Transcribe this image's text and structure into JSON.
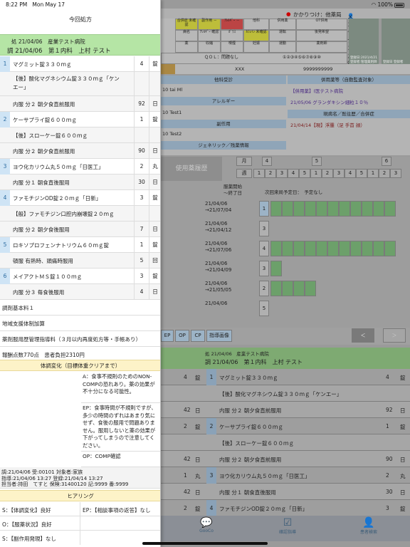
{
  "status": {
    "time": "8:22 PM",
    "date": "Mon May 17",
    "battery": "100%"
  },
  "header": {
    "kakaritsuke": "かかりつけ：他薬局",
    "user": "メンテナンス管理者"
  },
  "panel": {
    "title": "今回処方",
    "rx_line1": "処 21/04/06　産業テスト病院",
    "rx_line2": "調 21/04/06　第１内科　上村 テスト",
    "meds": [
      {
        "num": "1",
        "name": "マグミット錠３３０ｍｇ",
        "qty": "4",
        "unit": "錠"
      },
      {
        "name": "【後】酸化マグネシウム錠３３０ｍｇ「ケン",
        "name2": "エー」"
      },
      {
        "name": "内服 分２ 朝夕食直前服用",
        "qty": "92",
        "unit": "日"
      },
      {
        "num": "2",
        "name": "ケーサプライ錠６００ｍｇ",
        "qty": "1",
        "unit": "錠"
      },
      {
        "name": "【後】スローケー錠６００ｍｇ"
      },
      {
        "name": "内服 分２ 朝夕食直前服用",
        "qty": "90",
        "unit": "日"
      },
      {
        "num": "3",
        "name": "ヨウ化カリウム丸５０ｍｇ「日医工」",
        "qty": "2",
        "unit": "丸"
      },
      {
        "name": "内服 分１ 朝食直後服用",
        "qty": "30",
        "unit": "日"
      },
      {
        "num": "4",
        "name": "ファモチジンOD錠２０ｍｇ「日新」",
        "qty": "3",
        "unit": "錠"
      },
      {
        "name": "【般】ファモチジン口腔内崩壊錠２０ｍｇ"
      },
      {
        "name": "内服 分２ 朝夕食後服用",
        "qty": "7",
        "unit": "日"
      },
      {
        "num": "5",
        "name": "ロキソプロフェンナトリウム６０ｍｇ錠",
        "qty": "1",
        "unit": "錠"
      },
      {
        "name": "頓服 有熱時、頭痛時服用",
        "qty": "5",
        "unit": "回"
      },
      {
        "num": "6",
        "name": "メイアクトＭＳ錠１００ｍｇ",
        "qty": "3",
        "unit": "錠"
      },
      {
        "name": "内服 分３ 毎食後服用",
        "qty": "4",
        "unit": "日"
      }
    ],
    "fees": [
      "調剤基本料１",
      "地域支援体制加算",
      "薬剤服用歴管理指導料（３月以内再度処方等・手帳あり）",
      "報酬点数770点　患者負担2310円"
    ],
    "taichou_header": "体調変化（目標体重クリアまで）",
    "note_a": "A：食事不規則のためのNON-COMPの恐れあり。薬の効果が不十分になる可能性。",
    "note_ep": "EP：食事時間が不規則ですが、多少の時間のずれはあまり気にせず、食後の服用で問題ありません。服用しないと薬の効果が下がってしまうので注意してください。",
    "note_op": "OP：COMP確認",
    "record": [
      "調:21/04/06 受:00101 対象者:家族",
      "指導:21/04/06 13:27 登録:21/04/14 13:27",
      "担当者:持田　てすと 保険:31400120 記:9999 番:9999"
    ],
    "hearing_header": "ヒアリング",
    "hearing": [
      "S：【体調変化】良好",
      "EP：【相談事項の返答】なし",
      "O：【服薬状況】良好",
      "S：【副作用発現】なし"
    ]
  },
  "bg": {
    "grid_labels": [
      "合併症 未確認",
      "副作用 －",
      "ｱﾚﾙｷﾞｰ －",
      "他科",
      "併用薬",
      "OT併用",
      "病名",
      "ｱﾚﾙｷﾞｰ 確認",
      "ｶﾞﾗｽ",
      "ｶﾌｪｲﾝ 未確認",
      "運転",
      "後発希望",
      "薬",
      "収縮",
      "喫煙",
      "妊娠",
      "運動",
      "薬剤師"
    ],
    "qol": "ＱＯＬ：問題なし",
    "circles": "①②③④⑤⑥⑦⑧⑨⑩",
    "row_xxx": "XXX",
    "row_num": "9999999999",
    "photo1": "登録日:2021/4/21 登録者:管理薬剤師",
    "photo2": "登録日 登録者",
    "takai": "他科受診",
    "heiyou": "併用薬等（自動監査対象）",
    "t1": "10 tai Ml",
    "allergy": "アレルギー",
    "h1": "【併用薬】(医テスト病院",
    "h2": "21/05/06 グランダキシン細粒１０％",
    "t2": "10 Test1",
    "fukusayou": "副作用",
    "genbyou": "現病名／既往歴／合併症",
    "g1": "21/04/14【現】浮腫（足 手首 顔）",
    "t3": "10 Test2",
    "generic": "ジェネリック／残薬情報",
    "shiyou": "使用薬履歴",
    "tsuki": "月",
    "shuu": "週",
    "month_nums": [
      "4",
      "5",
      "6"
    ],
    "week_nums": [
      "1",
      "2",
      "3",
      "4",
      "5",
      "1",
      "2",
      "3",
      "4",
      "5",
      "1",
      "2",
      "3"
    ],
    "fuku_kaishi": "服薬開始",
    "shuuryou": "〜終了日",
    "jikai": "次回来局予定日：　予定なし",
    "hist": [
      {
        "d1": "21/04/06",
        "d2": "→21/07/04",
        "n": "1"
      },
      {
        "d1": "21/04/06",
        "d2": "→21/04/12",
        "n": "3"
      },
      {
        "d1": "21/04/06",
        "d2": "→21/07/06",
        "n": "4"
      },
      {
        "d1": "21/04/06",
        "d2": "→21/04/09",
        "n": "3"
      },
      {
        "d1": "21/04/06",
        "d2": "→21/05/05",
        "n": "2"
      },
      {
        "d1": "21/04/06",
        "d2": "",
        "n": "5"
      }
    ],
    "buttons": [
      "EP",
      "OP",
      "CP",
      "指導画像"
    ],
    "prev": "＜",
    "next": "＞",
    "rx1": "処 21/04/06　産業テスト病院",
    "rx2": "調 21/04/06　第１内科　上村 テスト",
    "rows": [
      {
        "lq": "4",
        "lu": "錠",
        "num": "1",
        "name": "マグミット錠３３０ｍｇ",
        "q": "4",
        "u": "錠"
      },
      {
        "name": "【後】酸化マグネシウム錠３３０ｍｇ「ケンエー」"
      },
      {
        "lq": "42",
        "lu": "日",
        "name": "内服 分２ 朝夕食直前服用",
        "q": "92",
        "u": "日"
      },
      {
        "lq": "2",
        "lu": "錠",
        "num": "2",
        "name": "ケーサプライ錠６００ｍｇ",
        "q": "1",
        "u": "錠"
      },
      {
        "name": "【後】スローケー錠６００ｍｇ"
      },
      {
        "lq": "42",
        "lu": "日",
        "name": "内服 分２ 朝夕食直前服用",
        "q": "90",
        "u": "日"
      },
      {
        "lq": "1",
        "lu": "丸",
        "num": "3",
        "name": "ヨウ化カリウム丸５０ｍｇ「日医工」",
        "q": "2",
        "u": "丸"
      },
      {
        "lq": "42",
        "lu": "日",
        "name": "内服 分１ 朝食直後服用",
        "q": "30",
        "u": "日"
      },
      {
        "lq": "2",
        "lu": "錠",
        "num": "4",
        "name": "ファモチジンOD錠２０ｍｇ「日新」",
        "q": "3",
        "u": "錠"
      }
    ],
    "tabs": [
      "GooCo",
      "確認指導",
      "患者検索"
    ]
  }
}
